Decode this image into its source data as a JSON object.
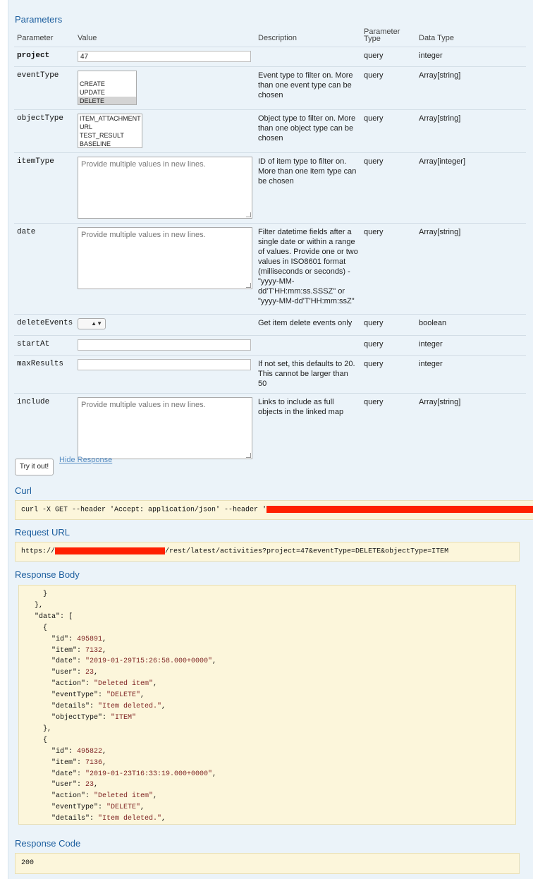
{
  "parameters": {
    "title": "Parameters",
    "headers": {
      "parameter": "Parameter",
      "value": "Value",
      "description": "Description",
      "param_type": "Parameter Type",
      "data_type": "Data Type"
    },
    "rows": [
      {
        "name": "project",
        "value": "47",
        "description": "",
        "param_type": "query",
        "data_type": "integer"
      },
      {
        "name": "eventType",
        "options": [
          "CREATE",
          "UPDATE",
          "DELETE"
        ],
        "selected": "DELETE",
        "description": "Event type to filter on. More than one event type can be chosen",
        "param_type": "query",
        "data_type": "Array[string]"
      },
      {
        "name": "objectType",
        "options": [
          "ITEM_ATTACHMENT",
          "URL",
          "TEST_RESULT",
          "BASELINE"
        ],
        "description": "Object type to filter on. More than one object type can be chosen",
        "param_type": "query",
        "data_type": "Array[string]"
      },
      {
        "name": "itemType",
        "placeholder": "Provide multiple values in new lines.",
        "description": "ID of item type to filter on. More than one item type can be chosen",
        "param_type": "query",
        "data_type": "Array[integer]"
      },
      {
        "name": "date",
        "placeholder": "Provide multiple values in new lines.",
        "description": "Filter datetime fields after a single date or within a range of values. Provide one or two values in ISO8601 format (milliseconds or seconds) - \"yyyy-MM-dd'T'HH:mm:ss.SSSZ\" or \"yyyy-MM-dd'T'HH:mm:ssZ\"",
        "param_type": "query",
        "data_type": "Array[string]"
      },
      {
        "name": "deleteEvents",
        "description": "Get item delete events only",
        "param_type": "query",
        "data_type": "boolean"
      },
      {
        "name": "startAt",
        "value": "",
        "description": "",
        "param_type": "query",
        "data_type": "integer"
      },
      {
        "name": "maxResults",
        "value": "",
        "description": "If not set, this defaults to 20. This cannot be larger than 50",
        "param_type": "query",
        "data_type": "integer"
      },
      {
        "name": "include",
        "placeholder": "Provide multiple values in new lines.",
        "description": "Links to include as full objects in the linked map",
        "param_type": "query",
        "data_type": "Array[string]"
      }
    ]
  },
  "actions": {
    "try_label": "Try it out!",
    "hide_label": "Hide Response"
  },
  "curl": {
    "title": "Curl",
    "command": "curl -X GET --header 'Accept: application/json' --header '"
  },
  "request_url": {
    "title": "Request URL",
    "prefix": "https://",
    "suffix": "/rest/latest/activities?project=47&eventType=DELETE&objectType=ITEM"
  },
  "response_body": {
    "title": "Response Body",
    "lines": [
      "    }",
      "  },",
      "  \"data\": [",
      "    {",
      "      \"id\": 495891,",
      "      \"item\": 7132,",
      "      \"date\": \"2019-01-29T15:26:58.000+0000\",",
      "      \"user\": 23,",
      "      \"action\": \"Deleted item\",",
      "      \"eventType\": \"DELETE\",",
      "      \"details\": \"Item deleted.\",",
      "      \"objectType\": \"ITEM\"",
      "    },",
      "    {",
      "      \"id\": 495822,",
      "      \"item\": 7136,",
      "      \"date\": \"2019-01-23T16:33:19.000+0000\",",
      "      \"user\": 23,",
      "      \"action\": \"Deleted item\",",
      "      \"eventType\": \"DELETE\",",
      "      \"details\": \"Item deleted.\","
    ]
  },
  "response_code": {
    "title": "Response Code",
    "value": "200"
  },
  "colors": {
    "panel_bg": "#ebf3f9",
    "title_blue": "#1c5e9e",
    "code_bg": "#fcf6db",
    "redaction": "#ff2000"
  }
}
